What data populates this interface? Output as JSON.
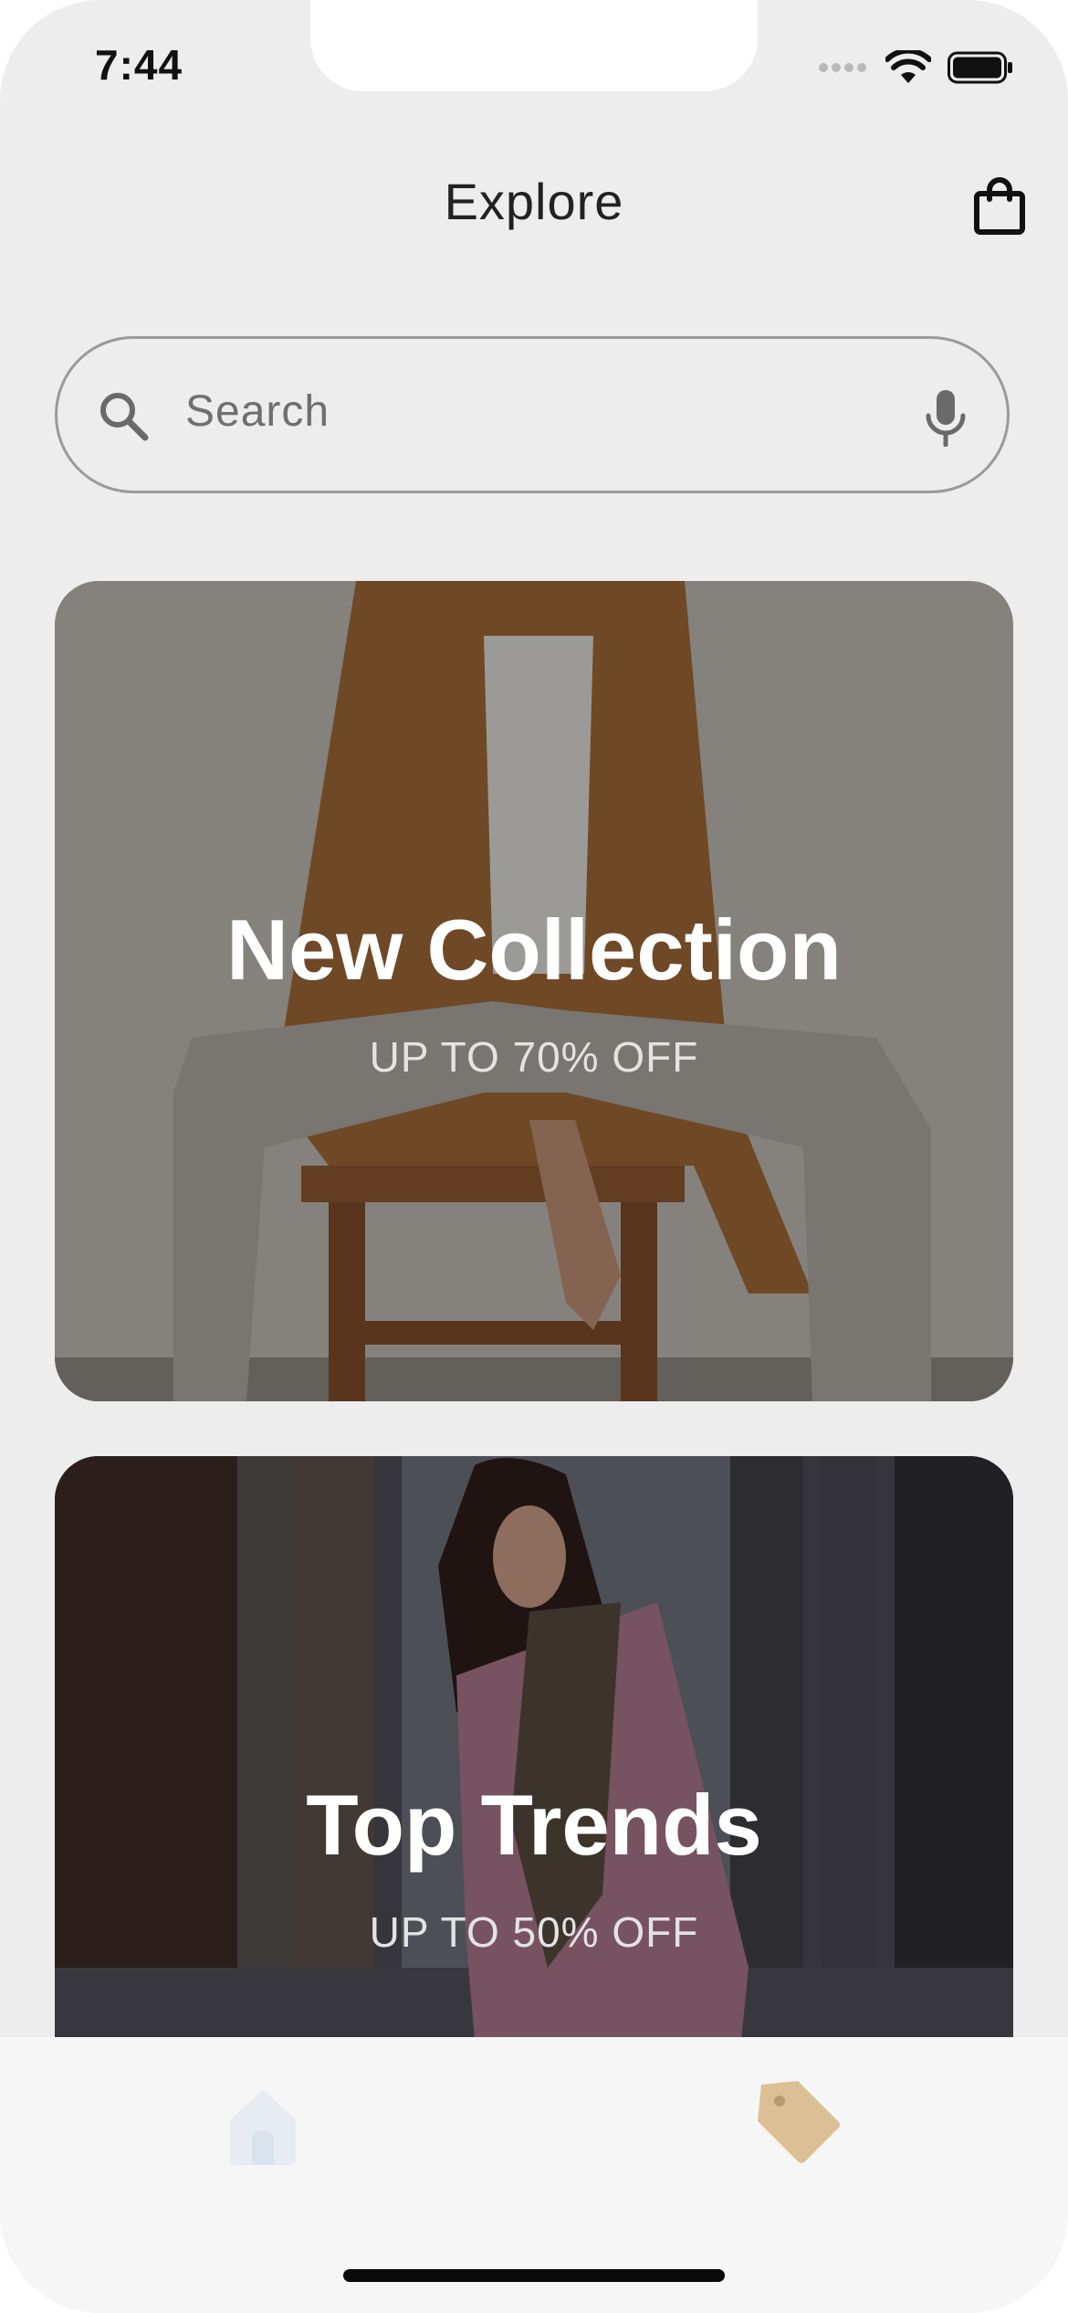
{
  "status_bar": {
    "time": "7:44",
    "icons": [
      "signal-dots-icon",
      "wifi-icon",
      "battery-icon"
    ]
  },
  "header": {
    "title": "Explore",
    "cart_icon": "shopping-bag-icon"
  },
  "search": {
    "placeholder": "Search",
    "left_icon": "search-icon",
    "right_icon": "microphone-icon"
  },
  "cards": [
    {
      "title": "New Collection",
      "subtitle": "UP TO 70% OFF"
    },
    {
      "title": "Top Trends",
      "subtitle": "UP TO 50% OFF"
    }
  ],
  "tab_bar": {
    "items": [
      {
        "icon": "home-icon",
        "active": false
      },
      {
        "icon": "tag-icon",
        "active": true
      }
    ],
    "colors": {
      "inactive": "#dfe7ef",
      "active": "#ddbf90"
    }
  }
}
